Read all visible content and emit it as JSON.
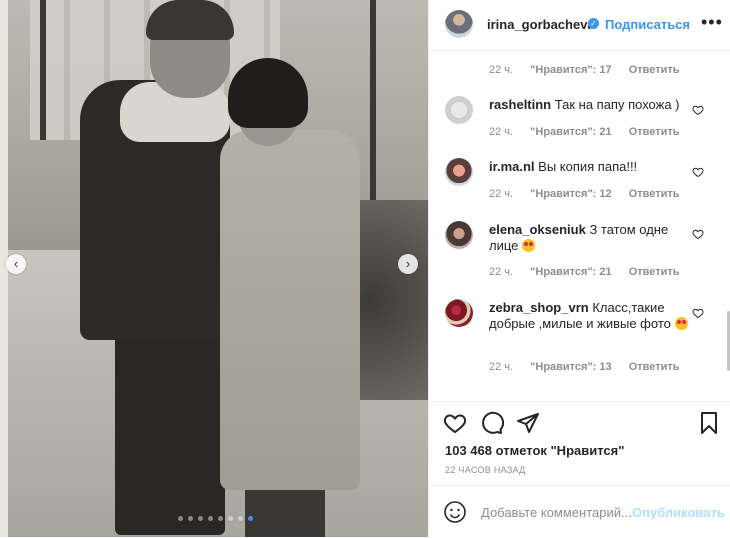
{
  "post": {
    "username": "irina_gorbacheva",
    "follow_label": "Подписаться",
    "more_label": "•••",
    "prev_label": "‹",
    "next_label": "›",
    "carousel_dots": 8,
    "carousel_active_index": 7
  },
  "comments": [
    {
      "user": "",
      "text": "",
      "time": "22 ч.",
      "likes": "\"Нравится\": 17",
      "reply": "Ответить"
    },
    {
      "user": "rasheltinn",
      "text": "Так на папу похожа )",
      "time": "22 ч.",
      "likes": "\"Нравится\": 21",
      "reply": "Ответить"
    },
    {
      "user": "ir.ma.nl",
      "text": "Вы копия папа!!!",
      "time": "22 ч.",
      "likes": "\"Нравится\": 12",
      "reply": "Ответить"
    },
    {
      "user": "elena_okseniuk",
      "text": "З татом одне лице",
      "time": "22 ч.",
      "likes": "\"Нравится\": 21",
      "reply": "Ответить"
    },
    {
      "user": "zebra_shop_vrn",
      "text": "Класс,такие добрые ,милые и живые фото",
      "time": "22 ч.",
      "likes": "\"Нравится\": 13",
      "reply": "Ответить"
    }
  ],
  "actions": {
    "likes_count": "103 468 отметок \"Нравится\"",
    "time_ago": "22 ЧАСОВ НАЗАД"
  },
  "composer": {
    "placeholder": "Добавьте комментарий...",
    "publish_label": "Опубликовать"
  },
  "colors": {
    "accent": "#3897f0",
    "publish_disabled": "#b2dffc",
    "muted": "#8e8e8e"
  }
}
